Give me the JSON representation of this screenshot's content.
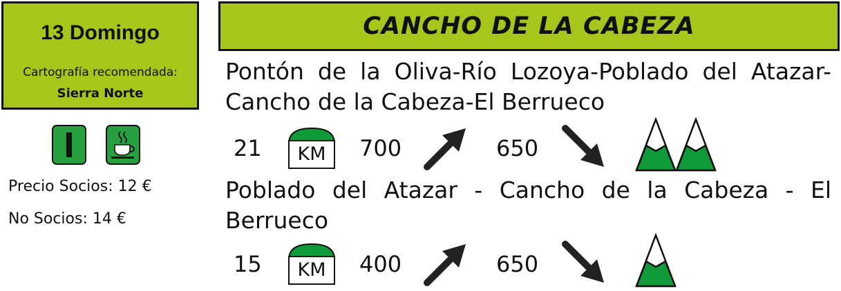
{
  "date_box": {
    "title": "13 Domingo",
    "carto_label": "Cartografía recomendada:",
    "carto_value": "Sierra Norte"
  },
  "header": {
    "title": "CANCHO DE LA CABEZA"
  },
  "prices": {
    "socios": "Precio Socios: 12 €",
    "no_socios": "No Socios: 14 €"
  },
  "icons": {
    "difficulty": "difficulty-level-1-icon",
    "food": "coffee-cup-icon",
    "distance": "km-icon",
    "ascent": "arrow-up-right-icon",
    "descent": "arrow-down-right-icon",
    "mountain": "mountain-icon"
  },
  "colors": {
    "accent": "#a6c61b",
    "badge_green": "#27a040",
    "mountain_green": "#119a3a"
  },
  "routes": [
    {
      "description": "Pontón de la Oliva-Río Lozoya-Poblado del Atazar-Cancho de la Cabeza-El Berrueco",
      "distance": "21",
      "km_label": "KM",
      "ascent": "700",
      "descent": "650"
    },
    {
      "description": "Poblado del Atazar - Cancho de la Cabeza - El Berrueco",
      "distance": "15",
      "km_label": "KM",
      "ascent": "400",
      "descent": "650"
    }
  ]
}
